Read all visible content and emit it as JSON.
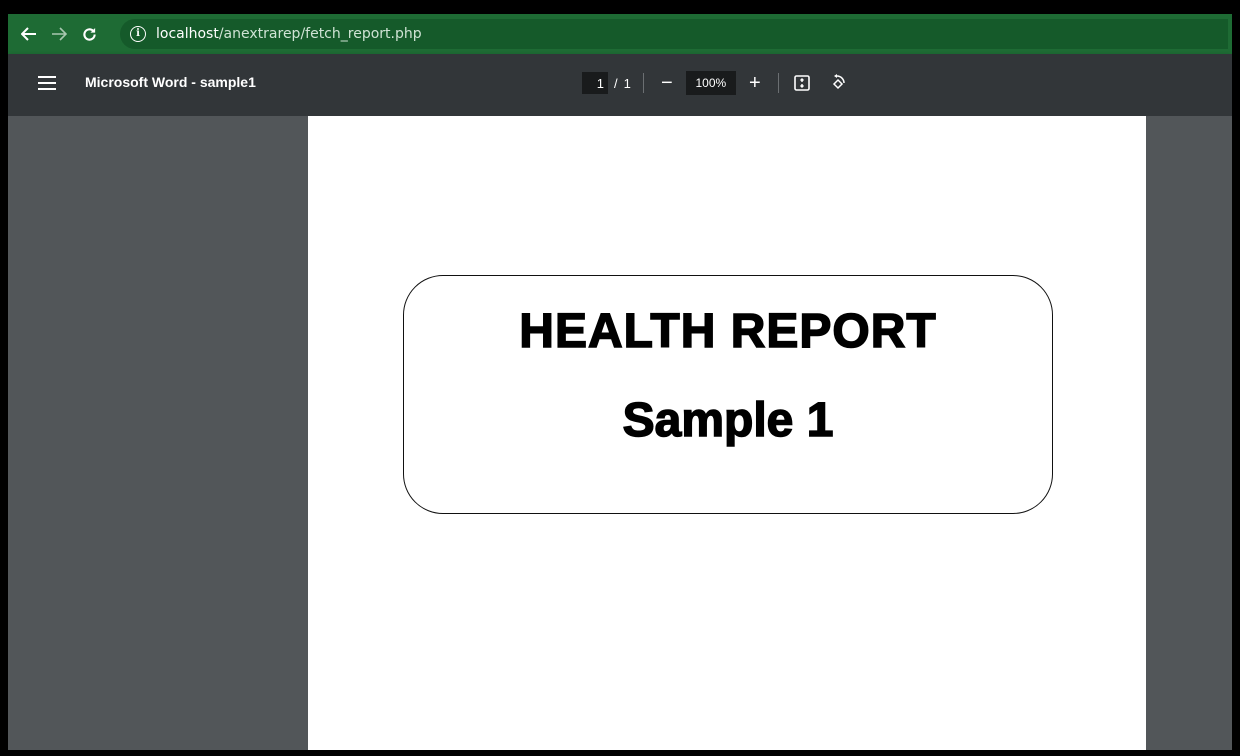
{
  "browser": {
    "url_host": "localhost",
    "url_path": "/anextrarep/fetch_report.php",
    "info_icon_glyph": "i",
    "colors": {
      "bar": "#1e6b34"
    }
  },
  "viewer": {
    "title": "Microsoft Word - sample1",
    "page_current": "1",
    "page_separator": "/",
    "page_total": "1",
    "zoom_out_label": "−",
    "zoom_value": "100%",
    "zoom_in_label": "+",
    "icons": [
      "menu-icon",
      "fit-page-icon",
      "rotate-icon"
    ]
  },
  "document": {
    "heading": "HEALTH REPORT",
    "subheading": "Sample 1"
  }
}
